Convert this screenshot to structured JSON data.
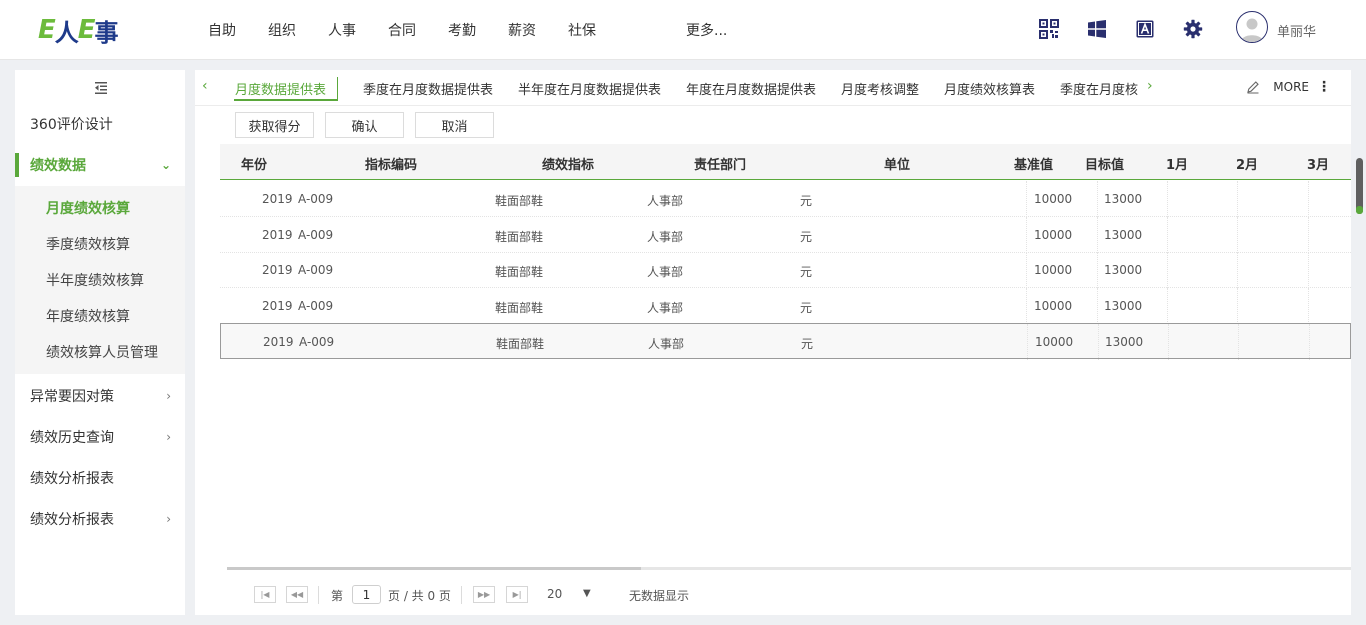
{
  "header": {
    "logo_text": "E人E事",
    "nav": [
      "自助",
      "组织",
      "人事",
      "合同",
      "考勤",
      "薪资",
      "社保"
    ],
    "nav_more": "更多...",
    "user_name": "单丽华"
  },
  "sidebar": {
    "items": [
      {
        "label": "360评价设计"
      },
      {
        "label": "绩效数据",
        "expanded": true
      },
      {
        "label": "异常要因对策"
      },
      {
        "label": "绩效历史查询"
      },
      {
        "label": "绩效分析报表"
      },
      {
        "label": "绩效分析报表"
      }
    ],
    "submenu": [
      "月度绩效核算",
      "季度绩效核算",
      "半年度绩效核算",
      "年度绩效核算",
      "绩效核算人员管理"
    ]
  },
  "tabs": [
    "月度数据提供表",
    "季度在月度数据提供表",
    "半年度在月度数据提供表",
    "年度在月度数据提供表",
    "月度考核调整",
    "月度绩效核算表",
    "季度在月度核"
  ],
  "more_label": "MORE",
  "toolbar": {
    "get_score": "获取得分",
    "confirm": "确认",
    "cancel": "取消"
  },
  "table": {
    "columns": [
      "年份",
      "指标编码",
      "绩效指标",
      "责任部门",
      "单位",
      "基准值",
      "目标值",
      "1月",
      "2月",
      "3月"
    ],
    "rows": [
      [
        "2019",
        "A-009",
        "鞋面部鞋",
        "人事部",
        "元",
        "10000",
        "13000"
      ],
      [
        "2019",
        "A-009",
        "鞋面部鞋",
        "人事部",
        "元",
        "10000",
        "13000"
      ],
      [
        "2019",
        "A-009",
        "鞋面部鞋",
        "人事部",
        "元",
        "10000",
        "13000"
      ],
      [
        "2019",
        "A-009",
        "鞋面部鞋",
        "人事部",
        "元",
        "10000",
        "13000"
      ],
      [
        "2019",
        "A-009",
        "鞋面部鞋",
        "人事部",
        "元",
        "10000",
        "13000"
      ]
    ],
    "selected_row": 5
  },
  "pager": {
    "page_prefix": "第",
    "page_value": "1",
    "page_suffix": "页 / 共 0 页",
    "page_size": "20",
    "no_data": "无数据显示"
  },
  "colors": {
    "accent": "#5aa83b",
    "brand_blue": "#1e3a8a"
  }
}
